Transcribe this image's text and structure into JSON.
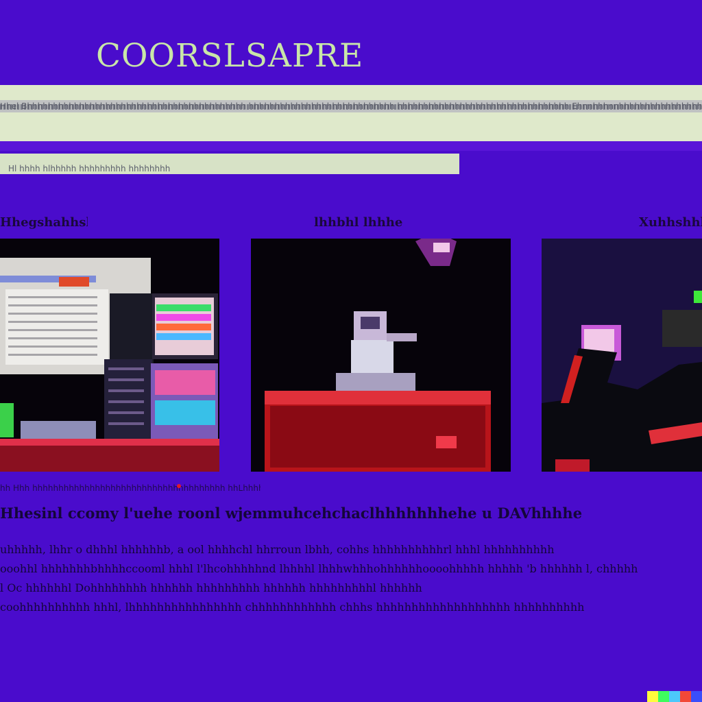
{
  "header": {
    "logo": "COORSLSAPRE",
    "band_text": "Hhel Bhhhhhhhhhhhhhhhhhhhhhhhhhhhhhhhhhhhhhhhhhh hhhhhhhhhhhhhhhhhhhhhhhhhhhh hhhhhhhhhhhhhhhhhhhhhhhhhhhhhhhhh Ehnnhhhnnhhhhhhhhhhhhhhhhhhhhhhhhhhh",
    "strip_text": "Hl    hhhh    hlhhhhh   hhhhhhhhh   hhhhhhhh"
  },
  "columns": [
    {
      "title": "Hhegshahhsl"
    },
    {
      "title": "lhhbhl lhhhe"
    },
    {
      "title": "Xuhhshhh"
    }
  ],
  "caption": "hh Hhh  hhhhhhhhhhhhhhhhhhhhhhhhhhhhhhhhhhhhh  hhLhhhhh",
  "article": {
    "heading": "Hhesinl ccomy l'uehe roonl wjemmuhcehchaclhhhhhhhehe u DAVhhhhe",
    "lines": [
      "uhhhhh, lhhr o dhhhl hhhhhhb, a ool hhhhchl hhrroun lbhh, cohhs hhhhhhhhhhrl hhhl hhhhhhhhhh",
      "ooohhl hhhhhhhbhhhhccooml hhhl l'lhcohhhhhnd lhhhhl lhhhwhhhohhhhhhoooohhhhh hhhhh 'b hhhhhh l, chhhhh",
      "l Oc hhhhhhl Dohhhhhhhh hhhhhh hhhhhhhhh hhhhhh hhhhhhhhhl hhhhhh",
      "coohhhhhhhhhh hhhl, lhhhhhhhhhhhhhhhh chhhhhhhhhhhh chhhs hhhhhhhhhhhhhhhhhhh hhhhhhhhhh"
    ]
  },
  "colors": {
    "background": "#4a0ccc",
    "logo": "#c9e6a8",
    "band": "#dfe9cb",
    "rule": "#5a16d8",
    "text": "#14063a"
  },
  "watermark": {
    "colors": [
      "#fffc3c",
      "#3efb5e",
      "#4cc8fb",
      "#f24838",
      "#3a4efb"
    ]
  }
}
